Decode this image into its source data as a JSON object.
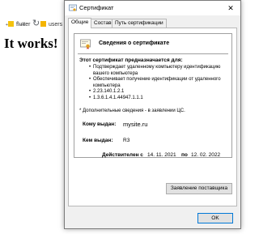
{
  "browser": {
    "back_icon": "arrow-left-icon",
    "forward_icon": "arrow-right-icon",
    "reload_icon": "reload-icon",
    "bookmarks": [
      {
        "label": "flutter",
        "icon": "folder-icon"
      },
      {
        "label": "users",
        "icon": "bookmark-icon"
      }
    ],
    "heading": "It works!"
  },
  "dialog": {
    "title": "Сертификат",
    "close_symbol": "✕",
    "tabs": [
      {
        "label": "Общие"
      },
      {
        "label": "Состав"
      },
      {
        "label": "Путь сертификации"
      }
    ],
    "info": {
      "title": "Сведения о сертификате",
      "purpose_heading": "Этот сертификат предназначается для:",
      "purposes": [
        "Подтверждает удаленному компьютеру идентификацию вашего компьютера",
        "Обеспечивает получение идентификации от удаленного компьютера",
        "2.23.140.1.2.1",
        "1.3.6.1.4.1.44947.1.1.1"
      ],
      "footnote": "* Дополнительные сведения - в заявлении ЦС."
    },
    "issued_to": {
      "label": "Кому выдан:",
      "value": "mysite.ru"
    },
    "issued_by": {
      "label": "Кем выдан:",
      "value": "R3"
    },
    "validity": {
      "label": "Действителен с",
      "from": "14. 11. 2021",
      "to_label": "по",
      "to": "12. 02. 2022"
    },
    "issuer_statement_button": "Заявление поставщика",
    "ok_button": "OK"
  },
  "colors": {
    "accent": "#0078d7",
    "dialog_bg": "#f0f0f0",
    "bookmark_folder": "#f4c20d",
    "bookmark_users": "#f4b400"
  }
}
